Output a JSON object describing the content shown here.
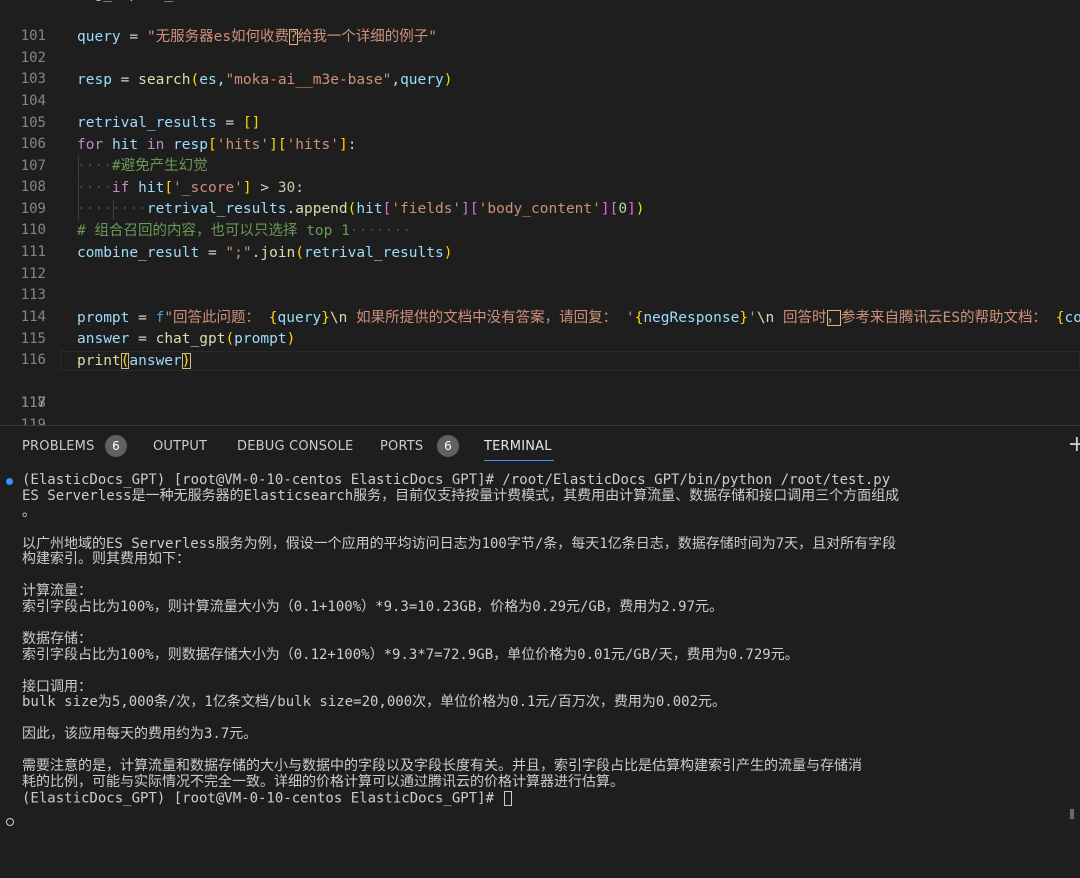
{
  "editor": {
    "line_numbers": [
      "101",
      "102",
      "103",
      "104",
      "105",
      "106",
      "107",
      "108",
      "109",
      "110",
      "111",
      "112",
      "113",
      "114",
      "115",
      "116",
      "117",
      "118",
      "119"
    ],
    "active_line": "117",
    "l102": {
      "var": "query",
      "eq": " = ",
      "str_a": "\"无服务器es如何收费",
      "str_q": "?",
      "str_b": "给我一个详细的例子\""
    },
    "l104": {
      "var": "resp",
      "eq": " = ",
      "fn": "search",
      "p1": "(",
      "arg1": "es",
      "c1": ",",
      "arg2": "\"moka-ai__m3e-base\"",
      "c2": ",",
      "arg3": "query",
      "p2": ")"
    },
    "l106": {
      "var": "retrival_results",
      "eq": " = ",
      "br": "[]"
    },
    "l107": {
      "kw_for": "for",
      "sp1": " ",
      "var_hit": "hit",
      "kw_in": " in ",
      "var_resp": "resp",
      "b1o": "[",
      "s1": "'hits'",
      "b1c": "]",
      "b2o": "[",
      "s2": "'hits'",
      "b2c": "]",
      "colon": ":"
    },
    "l108": {
      "comment": "#避免产生幻觉"
    },
    "l109": {
      "kw_if": "if",
      "var_hit": " hit",
      "bo": "[",
      "s": "'_score'",
      "bc": "]",
      "op": " > ",
      "num": "30",
      "colon": ":"
    },
    "l110": {
      "var": "retrival_results",
      "dot": ".",
      "fn": "append",
      "po": "(",
      "var_hit": "hit",
      "b1o": "[",
      "s1": "'fields'",
      "b1c": "]",
      "b2o": "[",
      "s2": "'body_content'",
      "b2c": "]",
      "b3o": "[",
      "num": "0",
      "b3c": "]",
      "pc": ")"
    },
    "l111": {
      "comment": "# 组合召回的内容，也可以只选择 top 1"
    },
    "l112": {
      "var": "combine_result",
      "eq": " = ",
      "str": "\";\"",
      "dot": ".",
      "fn": "join",
      "po": "(",
      "arg": "retrival_results",
      "pc": ")"
    },
    "l115": {
      "var": "prompt",
      "eq": " = ",
      "f": "f",
      "s1": "\"回答此问题：",
      "i1o": " {",
      "i1v": "query",
      "i1c": "}",
      "esc1": "\\n",
      "s2": " 如果所提供的文档中没有答案，请回复： '",
      "i2o": "{",
      "i2v": "negResponse",
      "i2c": "}",
      "s3": "'",
      "esc2": "\\n",
      "s4": " 回答时",
      "s4q": "，",
      "s5": "参考来自腾讯云ES的帮助文档： ",
      "i3o": "{",
      "i3v": "comb"
    },
    "l116": {
      "var": "answer",
      "eq": " = ",
      "fn": "chat_gpt",
      "po": "(",
      "arg": "prompt",
      "pc": ")"
    },
    "l117": {
      "fn": "print",
      "po": "(",
      "arg": "answer",
      "pc": ")"
    },
    "l101_partial": "msg_report_id = ..."
  },
  "panel": {
    "tabs": [
      {
        "label": "PROBLEMS",
        "badge": "6"
      },
      {
        "label": "OUTPUT"
      },
      {
        "label": "DEBUG CONSOLE"
      },
      {
        "label": "PORTS",
        "badge": "6"
      },
      {
        "label": "TERMINAL"
      }
    ],
    "add_label": "+"
  },
  "terminal": {
    "cmd_line": "(ElasticDocs_GPT) [root@VM-0-10-centos ElasticDocs_GPT]# /root/ElasticDocs_GPT/bin/python /root/test.py",
    "output": [
      "ES Serverless是一种无服务器的Elasticsearch服务，目前仅支持按量计费模式，其费用由计算流量、数据存储和接口调用三个方面组成",
      "。",
      "",
      "以广州地域的ES Serverless服务为例，假设一个应用的平均访问日志为100字节/条，每天1亿条日志，数据存储时间为7天，且对所有字段",
      "构建索引。则其费用如下：",
      "",
      "计算流量：",
      "索引字段占比为100%，则计算流量大小为（0.1+100%）*9.3=10.23GB，价格为0.29元/GB，费用为2.97元。",
      "",
      "数据存储：",
      "索引字段占比为100%，则数据存储大小为（0.12+100%）*9.3*7=72.9GB，单位价格为0.01元/GB/天，费用为0.729元。",
      "",
      "接口调用：",
      "bulk size为5,000条/次，1亿条文档/bulk size=20,000次，单位价格为0.1元/百万次，费用为0.002元。",
      "",
      "因此，该应用每天的费用约为3.7元。",
      "",
      "需要注意的是，计算流量和数据存储的大小与数据中的字段以及字段长度有关。并且，索引字段占比是估算构建索引产生的流量与存储消",
      "耗的比例，可能与实际情况不完全一致。详细的价格计算可以通过腾讯云的价格计算器进行估算。"
    ],
    "prompt_line": "(ElasticDocs_GPT) [root@VM-0-10-centos ElasticDocs_GPT]# "
  }
}
